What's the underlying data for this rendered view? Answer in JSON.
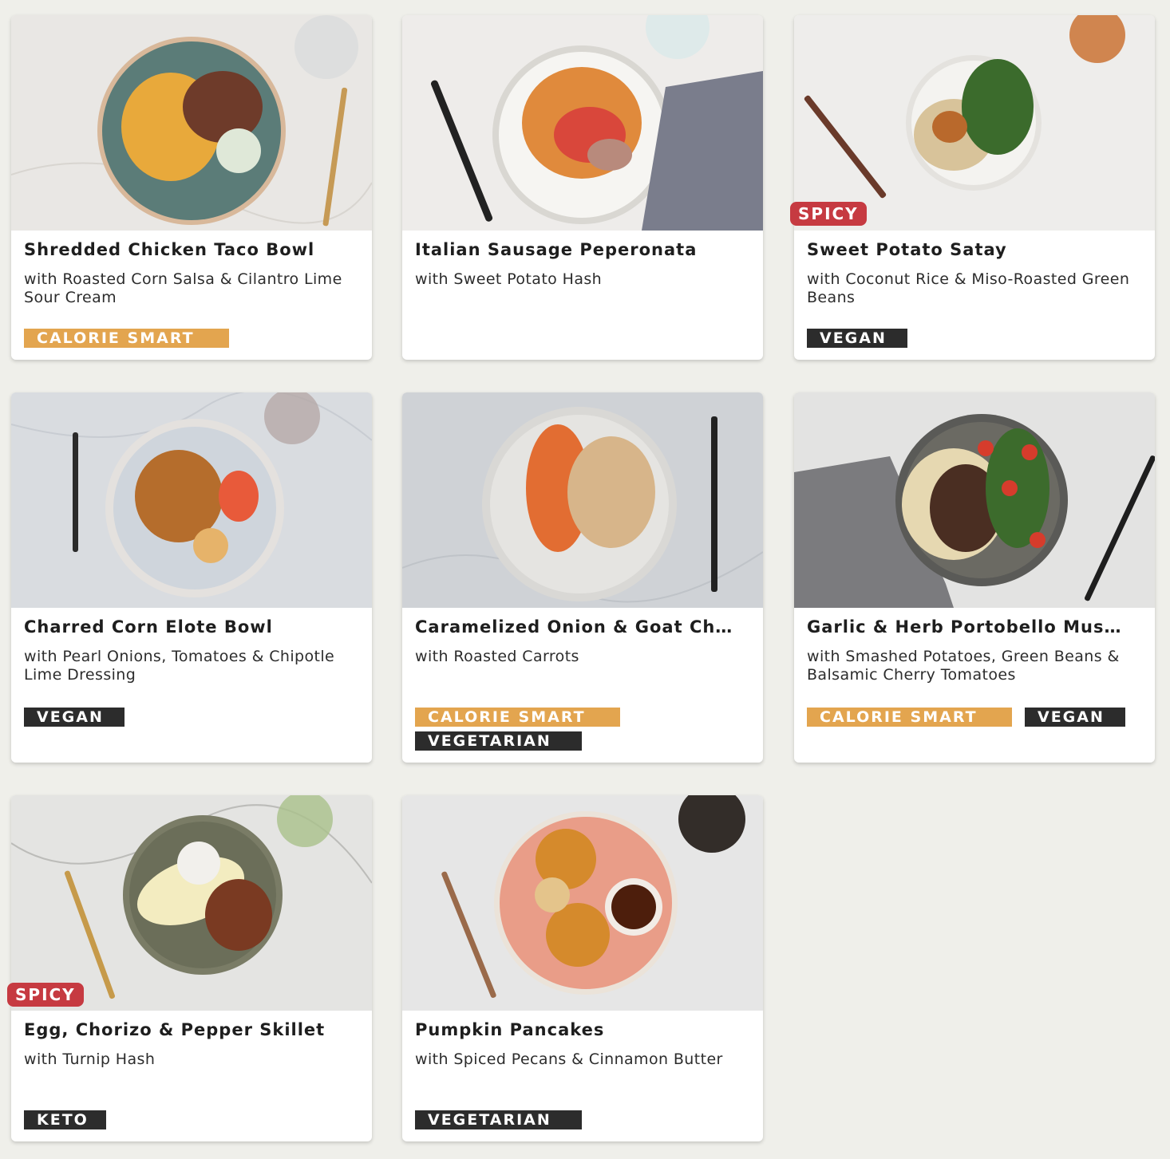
{
  "colors": {
    "page_background": "#efefea",
    "calorie_smart": "#e3a54f",
    "diet_tag": "#2c2c2c",
    "spicy": "#c63a41"
  },
  "meals": [
    {
      "title": "Shredded Chicken Taco Bowl",
      "subtitle": "with Roasted Corn Salsa & Cilantro Lime Sour Cream",
      "spicy": null,
      "tags": [
        "CALORIE SMART"
      ]
    },
    {
      "title": "Italian Sausage Peperonata",
      "subtitle": "with Sweet Potato Hash",
      "spicy": null,
      "tags": []
    },
    {
      "title": "Sweet Potato Satay",
      "subtitle": "with Coconut Rice & Miso-Roasted Green Beans",
      "spicy": "SPICY",
      "tags": [
        "VEGAN"
      ]
    },
    {
      "title": "Charred Corn Elote Bowl",
      "subtitle": "with Pearl Onions, Tomatoes & Chipotle Lime Dressing",
      "spicy": null,
      "tags": [
        "VEGAN"
      ]
    },
    {
      "title": "Caramelized Onion & Goat Ch…",
      "subtitle": "with Roasted Carrots",
      "spicy": null,
      "tags": [
        "CALORIE SMART",
        "VEGETARIAN"
      ]
    },
    {
      "title": "Garlic & Herb Portobello Mus…",
      "subtitle": "with Smashed Potatoes, Green Beans & Balsamic Cherry Tomatoes",
      "spicy": null,
      "tags": [
        "CALORIE SMART",
        "VEGAN"
      ]
    },
    {
      "title": "Egg, Chorizo & Pepper Skillet",
      "subtitle": "with Turnip Hash",
      "spicy": "SPICY",
      "tags": [
        "KETO"
      ]
    },
    {
      "title": "Pumpkin Pancakes",
      "subtitle": "with Spiced Pecans & Cinnamon Butter",
      "spicy": null,
      "tags": [
        "VEGETARIAN"
      ]
    }
  ]
}
